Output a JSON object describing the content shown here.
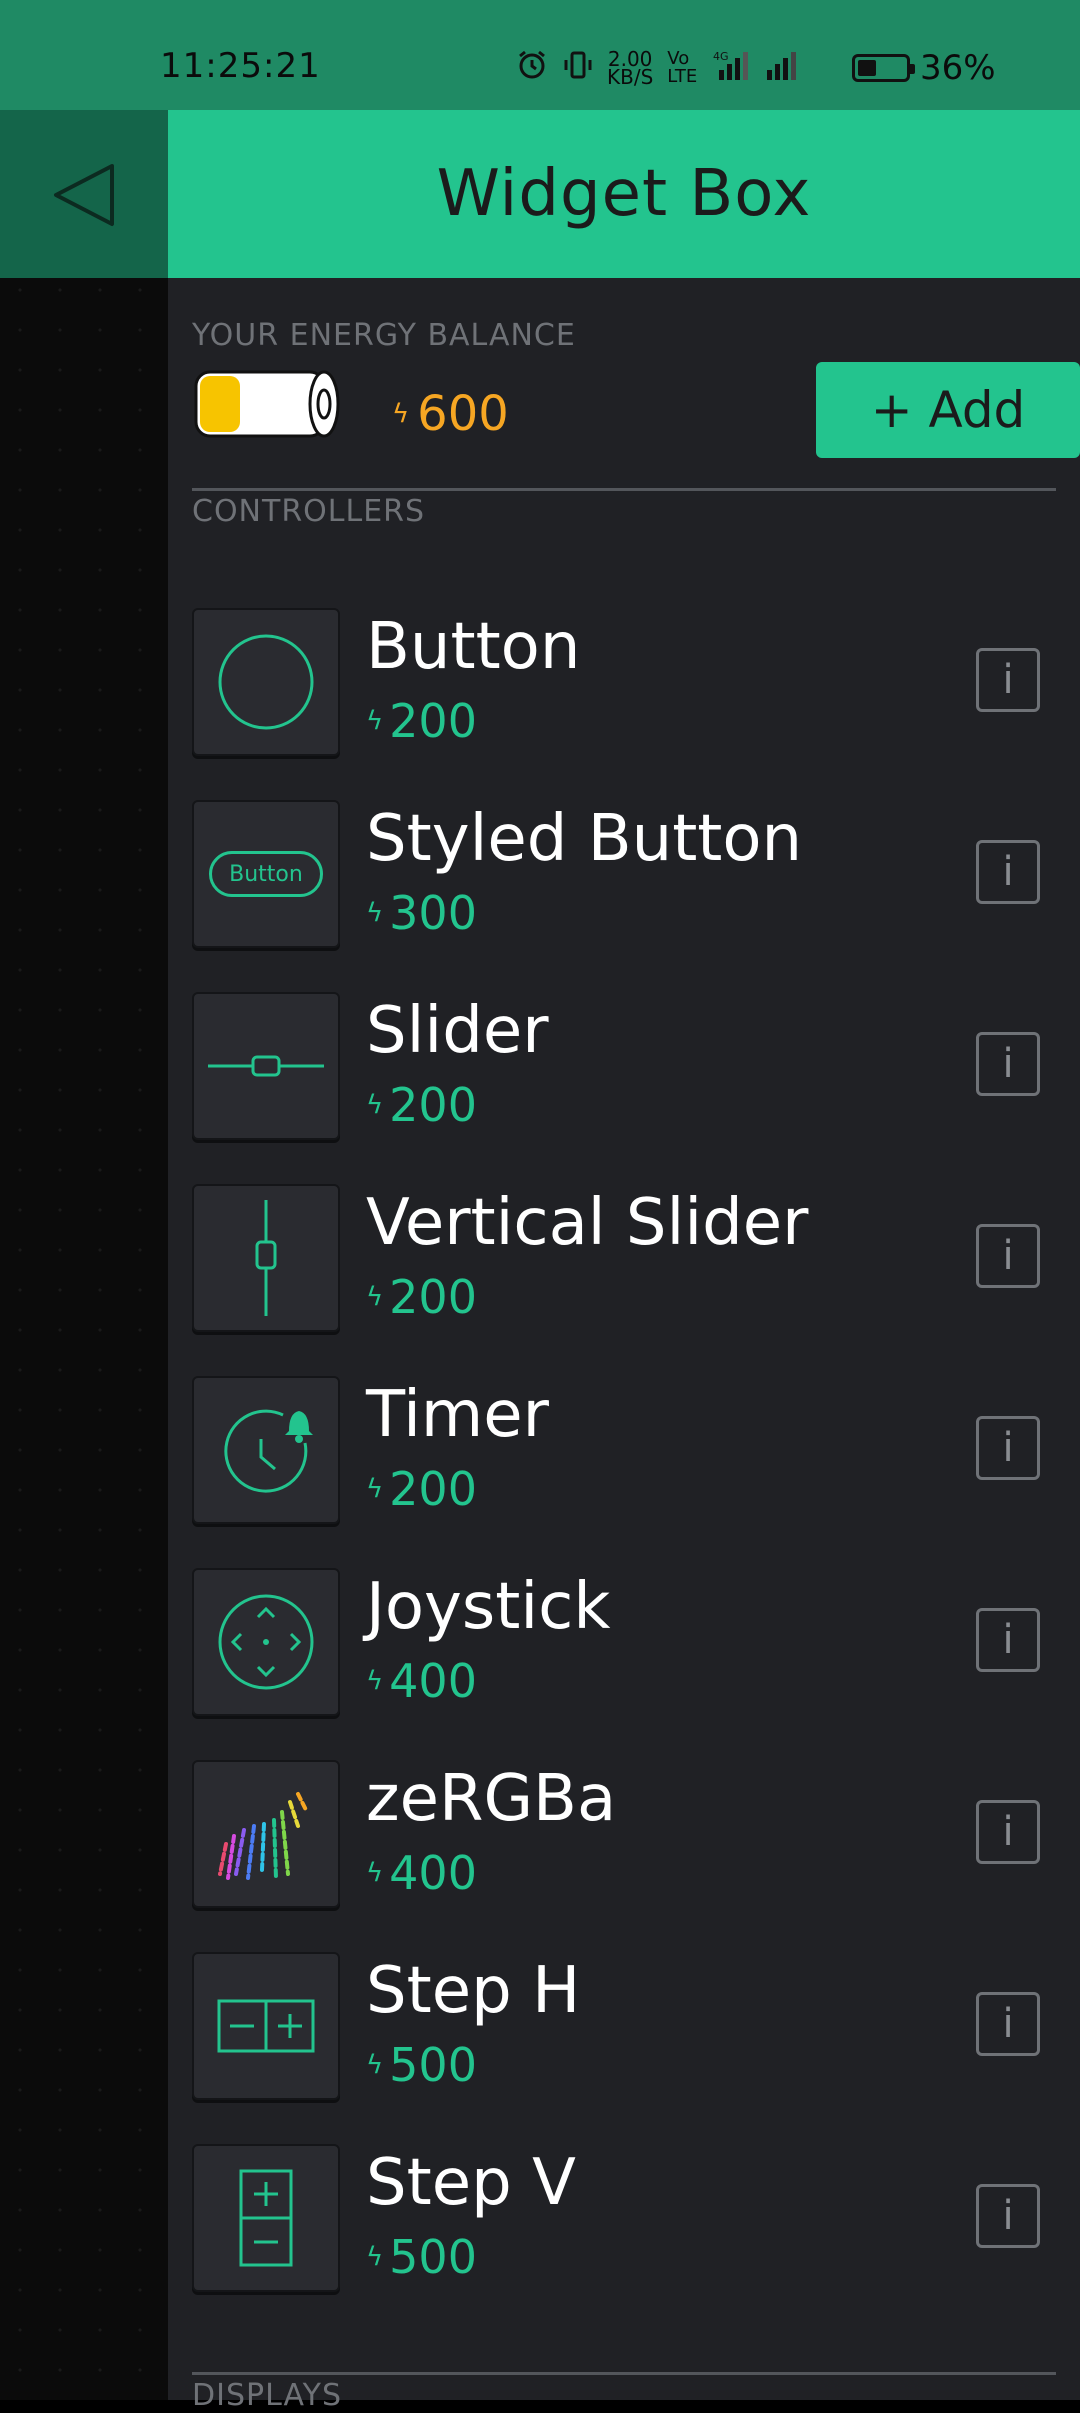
{
  "status_bar": {
    "time": "11:25:21",
    "net_speed": "2.00\nKB/S",
    "volte": "Vo LTE",
    "network": "4G",
    "battery": "36%"
  },
  "header": {
    "title": "Widget Box"
  },
  "energy": {
    "label": "YOUR ENERGY BALANCE",
    "value": "600",
    "add_label": "+ Add"
  },
  "sections": {
    "controllers": "CONTROLLERS",
    "displays": "DISPLAYS"
  },
  "widgets": [
    {
      "name": "Button",
      "cost": "200",
      "icon": "circle-button-icon"
    },
    {
      "name": "Styled Button",
      "cost": "300",
      "icon": "styled-button-icon",
      "icon_text": "Button"
    },
    {
      "name": "Slider",
      "cost": "200",
      "icon": "slider-icon"
    },
    {
      "name": "Vertical Slider",
      "cost": "200",
      "icon": "vertical-slider-icon"
    },
    {
      "name": "Timer",
      "cost": "200",
      "icon": "timer-icon"
    },
    {
      "name": "Joystick",
      "cost": "400",
      "icon": "joystick-icon"
    },
    {
      "name": "zeRGBa",
      "cost": "400",
      "icon": "zebra-icon"
    },
    {
      "name": "Step H",
      "cost": "500",
      "icon": "step-h-icon"
    },
    {
      "name": "Step V",
      "cost": "500",
      "icon": "step-v-icon"
    }
  ],
  "info_label": "i",
  "colors": {
    "accent": "#23c48e",
    "energy": "#f6a623",
    "panel": "#202125"
  }
}
